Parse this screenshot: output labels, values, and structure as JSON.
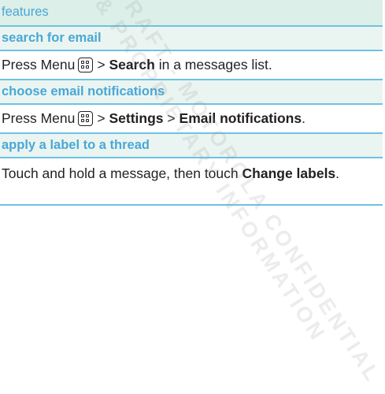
{
  "table": {
    "header": "features",
    "features": [
      {
        "title": "search for email",
        "desc_prefix": "Press Menu",
        "menu_icon": "menu-key-icon",
        "desc_parts": [
          ">",
          "Search",
          "in a messages list."
        ]
      },
      {
        "title": "choose email notifications",
        "desc_prefix": "Press Menu",
        "menu_icon": "menu-key-icon",
        "desc_parts": [
          ">",
          "Settings",
          ">",
          "Email notifications",
          "."
        ]
      },
      {
        "title": "apply a label to a thread",
        "desc_parts": [
          "Touch and hold a message, then touch",
          "Change labels",
          "."
        ]
      }
    ]
  },
  "watermark": {
    "line1": "DRAFT - MOTOROLA CONFIDENTIAL",
    "line2": "& PROPRIETARY INFORMATION"
  },
  "colors": {
    "accent_blue": "#4aa7d6",
    "border_blue": "#6ec1e4",
    "header_bg": "#dcefe8",
    "title_bg": "#eaf5f1",
    "text": "#231f20"
  }
}
